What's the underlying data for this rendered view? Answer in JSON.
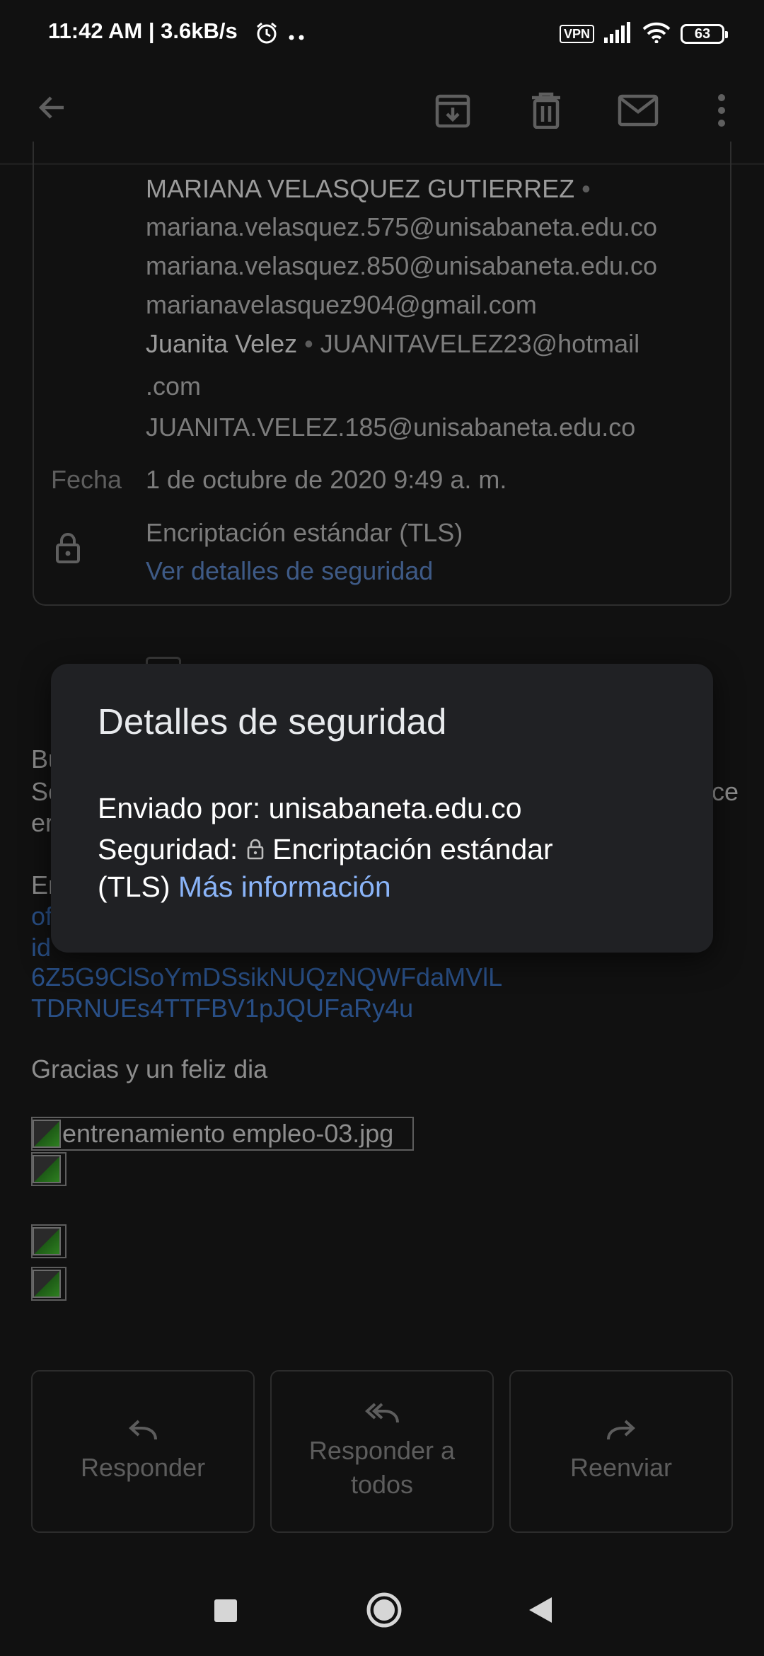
{
  "status_bar": {
    "time": "11:42 AM | 3.6kB/s",
    "vpn": "VPN",
    "battery": "63"
  },
  "header": {
    "recipients": [
      {
        "name": "MARIANA VELASQUEZ GUTIERREZ",
        "email": ""
      },
      {
        "name": "",
        "email": "mariana.velasquez.575@unisabaneta.edu.co"
      },
      {
        "name": "",
        "email": "mariana.velasquez.850@unisabaneta.edu.co"
      },
      {
        "name": "",
        "email": "marianavelasquez904@gmail.com"
      },
      {
        "name": "Juanita Velez",
        "email": "JUANITAVELEZ23@hotmail"
      },
      {
        "name": "",
        "email": ".com"
      },
      {
        "name": "",
        "email": "JUANITA.VELEZ.185@unisabaneta.edu.co"
      }
    ],
    "date_label": "Fecha",
    "date_value": "1 de octubre de 2020 9:49 a. m.",
    "encryption": "Encriptación estándar (TLS)",
    "security_link": "Ver detalles de seguridad"
  },
  "body": {
    "line_bu": "Bu",
    "line_so": "Sc",
    "line_ce": "ce",
    "line_en1": "er",
    "line_en2": "En",
    "link_start1": "of",
    "link_start2": "id",
    "link_line3": "6Z5G9ClSoYmDSsikNUQzNQWFdaMVlL",
    "link_line4": "TDRNUEs4TTFBV1pJQUFaRy4u",
    "thanks": "Gracias y un feliz dia",
    "image_alt": "entrenamiento empleo-03.jpg"
  },
  "actions": {
    "reply": "Responder",
    "reply_all_1": "Responder a",
    "reply_all_2": "todos",
    "forward": "Reenviar"
  },
  "dialog": {
    "title": "Detalles de seguridad",
    "sent_by": "Enviado por: unisabaneta.edu.co",
    "security_label": "Seguridad:",
    "security_value": "Encriptación estándar",
    "security_tls": "(TLS)",
    "more_info": "Más información"
  }
}
